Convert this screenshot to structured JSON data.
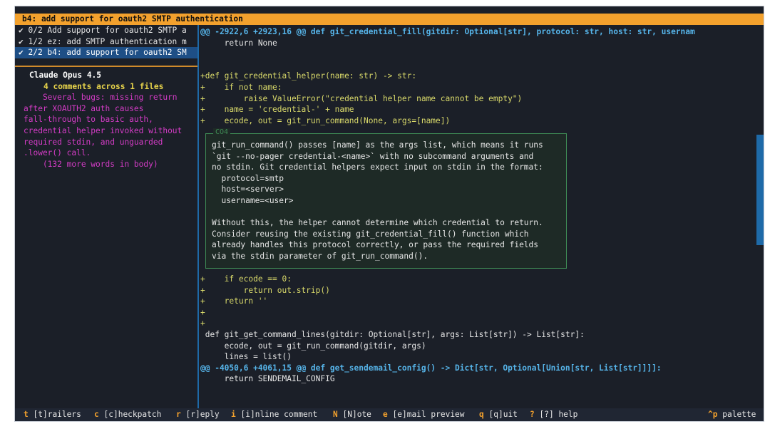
{
  "title": "b4: add support for oauth2 SMTP authentication",
  "patches": [
    {
      "label": "✔ 0/2 Add support for oauth2 SMTP a",
      "selected": false
    },
    {
      "label": "✔ 1/2 ez: add SMTP authentication m",
      "selected": false
    },
    {
      "label": "✔ 2/2 b4: add support for oauth2 SM",
      "selected": true
    }
  ],
  "review": {
    "author": "Claude Opus 4.5",
    "count": "4 comments across 1 files",
    "body": [
      "    Several bugs: missing return",
      "after XOAUTH2 auth causes",
      "fall-through to basic auth,",
      "credential helper invoked without",
      "required stdin, and unguarded",
      ".lower() call.",
      "    (132 more words in body)"
    ]
  },
  "diff": {
    "lines": [
      {
        "kind": "hunk",
        "text": "@@ -2922,6 +2923,16 @@ def git_credential_fill(gitdir: Optional[str], protocol: str, host: str, usernam"
      },
      {
        "kind": "ctx",
        "text": "     return None"
      },
      {
        "kind": "ctx",
        "text": ""
      },
      {
        "kind": "ctx",
        "text": ""
      },
      {
        "kind": "add",
        "text": "+def git_credential_helper(name: str) -> str:"
      },
      {
        "kind": "add",
        "text": "+    if not name:"
      },
      {
        "kind": "add",
        "text": "+        raise ValueError(\"credential helper name cannot be empty\")"
      },
      {
        "kind": "add",
        "text": "+    name = 'credential-' + name"
      },
      {
        "kind": "add",
        "text": "+    ecode, out = git_run_command(None, args=[name])"
      }
    ],
    "lines_after": [
      {
        "kind": "add",
        "text": "+    if ecode == 0:"
      },
      {
        "kind": "add",
        "text": "+        return out.strip()"
      },
      {
        "kind": "add",
        "text": "+    return ''"
      },
      {
        "kind": "add",
        "text": "+"
      },
      {
        "kind": "add",
        "text": "+"
      },
      {
        "kind": "ctx",
        "text": " def git_get_command_lines(gitdir: Optional[str], args: List[str]) -> List[str]:"
      },
      {
        "kind": "ctx",
        "text": "     ecode, out = git_run_command(gitdir, args)"
      },
      {
        "kind": "ctx",
        "text": "     lines = list()"
      },
      {
        "kind": "hunk",
        "text": "@@ -4050,6 +4061,15 @@ def get_sendemail_config() -> Dict[str, Optional[Union[str, List[str]]]]:"
      },
      {
        "kind": "ctx",
        "text": "     return SENDEMAIL_CONFIG"
      }
    ]
  },
  "comment": {
    "title": "CO4",
    "lines": [
      "git_run_command() passes [name] as the args list, which means it runs",
      "`git --no-pager credential-<name>` with no subcommand arguments and",
      "no stdin. Git credential helpers expect input on stdin in the format:",
      "  protocol=smtp",
      "  host=<server>",
      "  username=<user>",
      "",
      "Without this, the helper cannot determine which credential to return.",
      "Consider reusing the existing git_credential_fill() function which",
      "already handles this protocol correctly, or pass the required fields",
      "via the stdin parameter of git_run_command()."
    ]
  },
  "statusbar": {
    "items": [
      {
        "key": "t",
        "label": "[t]railers"
      },
      {
        "key": "c",
        "label": "[c]heckpatch"
      },
      {
        "key": "r",
        "label": "[r]eply"
      },
      {
        "key": "i",
        "label": "[i]nline comment"
      },
      {
        "key": "N",
        "label": "[N]ote"
      },
      {
        "key": "e",
        "label": "[e]mail preview"
      },
      {
        "key": "q",
        "label": "[q]uit"
      },
      {
        "key": "?",
        "label": "[?] help"
      }
    ],
    "palette_key": "^p",
    "palette_label": "palette"
  },
  "colors": {
    "accent": "#f3a12d",
    "selection": "#1e4f86",
    "hunk": "#56b4e9",
    "added": "#d9d96a",
    "review_body": "#d43cc6",
    "comment_border": "#3f8c55"
  }
}
